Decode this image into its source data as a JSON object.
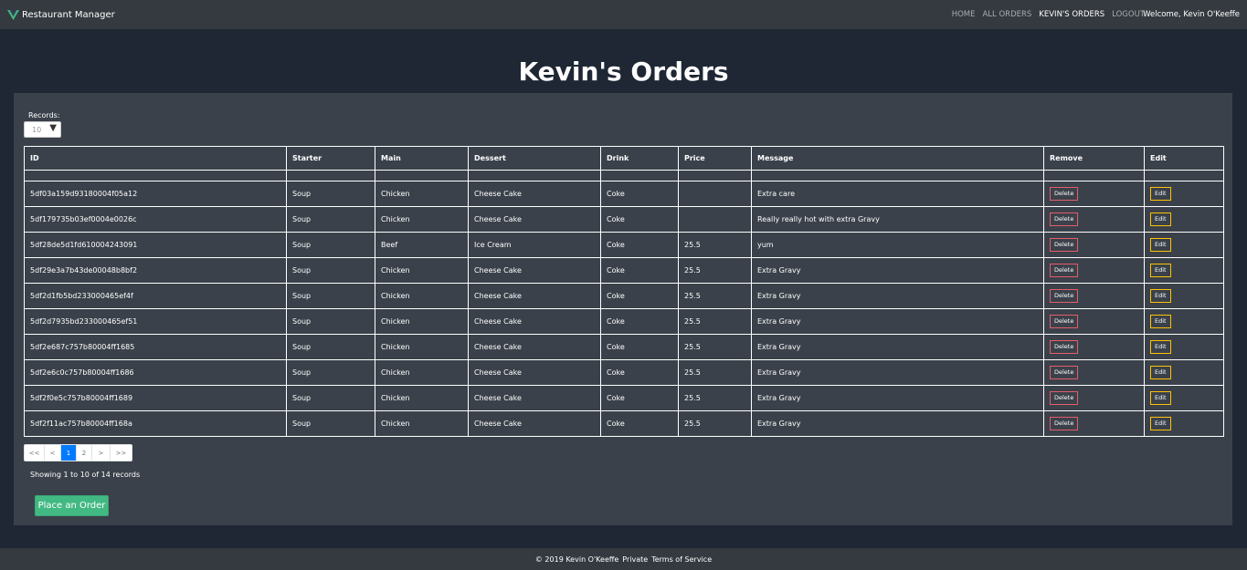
{
  "navbar": {
    "brand": "Restaurant Manager",
    "links": [
      {
        "label": "HOME",
        "active": false
      },
      {
        "label": "ALL ORDERS",
        "active": false
      },
      {
        "label": "KEVIN'S ORDERS",
        "active": true
      },
      {
        "label": "LOGOUT",
        "active": false
      }
    ],
    "welcome": "Welcome, Kevin O'Keeffe"
  },
  "page": {
    "title": "Kevin's Orders"
  },
  "records": {
    "label": "Records:",
    "value": "10"
  },
  "table": {
    "headers": [
      "ID",
      "Starter",
      "Main",
      "Dessert",
      "Drink",
      "Price",
      "Message",
      "Remove",
      "Edit"
    ],
    "delete_label": "Delete",
    "edit_label": "Edit",
    "rows": [
      {
        "id": "5df03a159d93180004f05a12",
        "starter": "Soup",
        "main": "Chicken",
        "dessert": "Cheese Cake",
        "drink": "Coke",
        "price": "",
        "message": "Extra care"
      },
      {
        "id": "5df179735b03ef0004e0026c",
        "starter": "Soup",
        "main": "Chicken",
        "dessert": "Cheese Cake",
        "drink": "Coke",
        "price": "",
        "message": "Really really hot with extra Gravy"
      },
      {
        "id": "5df28de5d1fd610004243091",
        "starter": "Soup",
        "main": "Beef",
        "dessert": "Ice Cream",
        "drink": "Coke",
        "price": "25.5",
        "message": "yum"
      },
      {
        "id": "5df29e3a7b43de00048b8bf2",
        "starter": "Soup",
        "main": "Chicken",
        "dessert": "Cheese Cake",
        "drink": "Coke",
        "price": "25.5",
        "message": "Extra Gravy"
      },
      {
        "id": "5df2d1fb5bd233000465ef4f",
        "starter": "Soup",
        "main": "Chicken",
        "dessert": "Cheese Cake",
        "drink": "Coke",
        "price": "25.5",
        "message": "Extra Gravy"
      },
      {
        "id": "5df2d7935bd233000465ef51",
        "starter": "Soup",
        "main": "Chicken",
        "dessert": "Cheese Cake",
        "drink": "Coke",
        "price": "25.5",
        "message": "Extra Gravy"
      },
      {
        "id": "5df2e687c757b80004ff1685",
        "starter": "Soup",
        "main": "Chicken",
        "dessert": "Cheese Cake",
        "drink": "Coke",
        "price": "25.5",
        "message": "Extra Gravy"
      },
      {
        "id": "5df2e6c0c757b80004ff1686",
        "starter": "Soup",
        "main": "Chicken",
        "dessert": "Cheese Cake",
        "drink": "Coke",
        "price": "25.5",
        "message": "Extra Gravy"
      },
      {
        "id": "5df2f0e5c757b80004ff1689",
        "starter": "Soup",
        "main": "Chicken",
        "dessert": "Cheese Cake",
        "drink": "Coke",
        "price": "25.5",
        "message": "Extra Gravy"
      },
      {
        "id": "5df2f11ac757b80004ff168a",
        "starter": "Soup",
        "main": "Chicken",
        "dessert": "Cheese Cake",
        "drink": "Coke",
        "price": "25.5",
        "message": "Extra Gravy"
      }
    ]
  },
  "pagination": {
    "items": [
      {
        "label": "<<",
        "active": false
      },
      {
        "label": "<",
        "active": false
      },
      {
        "label": "1",
        "active": true
      },
      {
        "label": "2",
        "active": false
      },
      {
        "label": ">",
        "active": false
      },
      {
        "label": ">>",
        "active": false
      }
    ],
    "showing": "Showing 1 to 10 of 14 records"
  },
  "actions": {
    "place_order": "Place an Order"
  },
  "footer": {
    "copyright": "© 2019 Kevin O'Keeffe",
    "private": "Private",
    "terms": "Terms of Service"
  },
  "colors": {
    "background": "#1e2733",
    "navbar": "#343a40",
    "panel": "#3a414a",
    "accent_green": "#42b883",
    "delete_border": "#e35d6a",
    "edit_border": "#ffc107",
    "page_active": "#007bff"
  },
  "icons": {
    "brand_logo": "vue-logo-icon",
    "select_caret": "caret-down-icon"
  }
}
